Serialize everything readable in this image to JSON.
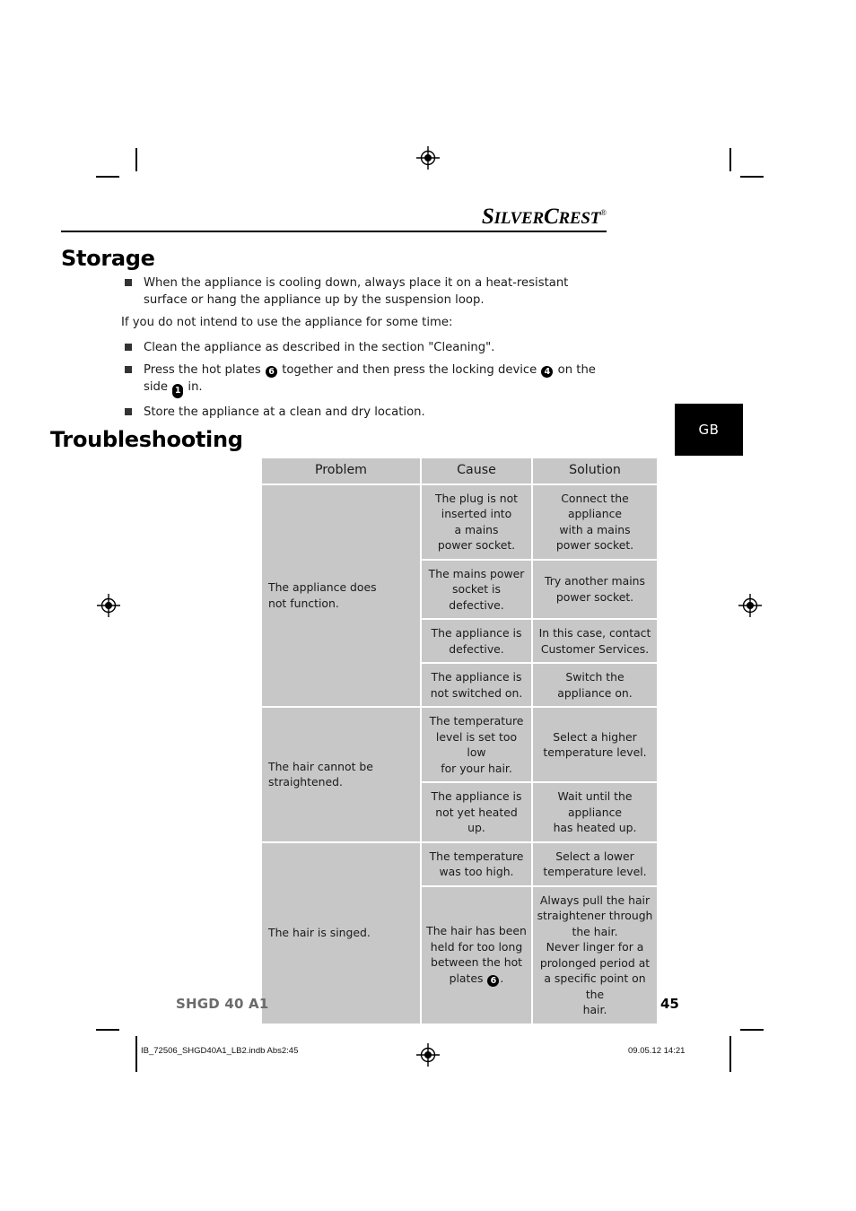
{
  "brand": {
    "name_part1": "S",
    "name_part2": "ILVER",
    "name_part3": "C",
    "name_part4": "REST",
    "trademark": "®"
  },
  "language_tab": {
    "label": "GB"
  },
  "sections": {
    "storage": {
      "heading": "Storage",
      "bullets_before": [
        "When the appliance is cooling down, always place it on a heat-resistant surface or hang the appliance up by the suspension loop."
      ],
      "paragraph": "If you do not intend to use the appliance for some time:",
      "bullets_after": [
        {
          "text": "Clean the appliance as described in the section \"Cleaning\"."
        },
        {
          "segments": [
            {
              "kind": "text",
              "value": "Press the hot plates "
            },
            {
              "kind": "ref",
              "value": "6",
              "shape": "circle"
            },
            {
              "kind": "text",
              "value": " together and then press the locking device "
            },
            {
              "kind": "ref",
              "value": "4",
              "shape": "circle"
            },
            {
              "kind": "text",
              "value": " on the side "
            },
            {
              "kind": "ref",
              "value": "1",
              "shape": "pill"
            },
            {
              "kind": "text",
              "value": " in."
            }
          ]
        },
        {
          "text": "Store the appliance at a clean and dry location."
        }
      ]
    },
    "troubleshooting": {
      "heading": "Troubleshooting",
      "table": {
        "columns": [
          "Problem",
          "Cause",
          "Solution"
        ],
        "rows": [
          {
            "problem": "The appliance does\nnot function.",
            "problem_rowspan": 4,
            "cause": "The plug is not\ninserted into\na mains\npower socket.",
            "solution": "Connect the appliance\nwith a mains\npower socket."
          },
          {
            "cause": "The mains power\nsocket is defective.",
            "solution": "Try another mains\npower socket."
          },
          {
            "cause": "The appliance is\ndefective.",
            "solution": "In this case, contact\nCustomer Services."
          },
          {
            "cause": "The appliance is\nnot switched on.",
            "solution": "Switch the\nappliance on."
          },
          {
            "problem": "The hair cannot be\nstraightened.",
            "problem_rowspan": 2,
            "cause": "The temperature\nlevel is set too low\nfor your hair.",
            "solution": "Select a higher\ntemperature level."
          },
          {
            "cause": "The appliance is\nnot yet heated up.",
            "solution": "Wait until the appliance\nhas heated up."
          },
          {
            "problem": "The hair is singed.",
            "problem_rowspan": 2,
            "cause": "The temperature\nwas too high.",
            "solution": "Select a lower\ntemperature level."
          },
          {
            "cause_segments": [
              {
                "kind": "text",
                "value": "The hair has been\nheld for too long\nbetween the hot\nplates "
              },
              {
                "kind": "ref",
                "value": "6",
                "shape": "circle"
              },
              {
                "kind": "text",
                "value": "."
              }
            ],
            "solution": "Always pull the hair\nstraightener through\nthe hair.\nNever linger for a\nprolonged period at\na specific point on the\nhair."
          }
        ]
      }
    }
  },
  "footer": {
    "model": "SHGD 40 A1",
    "page_number": "45",
    "imprint_left": "IB_72506_SHGD40A1_LB2.indb   Abs2:45",
    "imprint_right": "09.05.12   14:21"
  },
  "colors": {
    "table_cell_bg": "#c7c7c7",
    "lang_tab_bg": "#000000",
    "model_text": "#6b6b6b"
  }
}
